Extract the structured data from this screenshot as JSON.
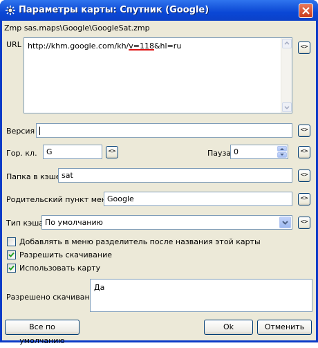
{
  "window": {
    "title": "Параметры карты: Спутник (Google)"
  },
  "zmp_line": "Zmp  sas.maps\\Google\\GoogleSat.zmp",
  "url": {
    "label": "URL",
    "value_prefix": "http://khm.google.com/kh/",
    "value_highlight": "v=118",
    "value_suffix": "&hl=ru",
    "reset_label": "<>"
  },
  "version": {
    "label": "Версия",
    "value": "",
    "reset_label": "<>"
  },
  "hotkey": {
    "label": "Гор. кл.",
    "value": "G",
    "reset_label": "<>"
  },
  "pause": {
    "label": "Пауза",
    "value": "0",
    "reset_label": "<>"
  },
  "cache_folder": {
    "label": "Папка в кэше",
    "value": "sat",
    "reset_label": "<>"
  },
  "parent_menu": {
    "label": "Родительский пункт меню",
    "value": "Google",
    "reset_label": "<>"
  },
  "cache_type": {
    "label": "Тип кэша",
    "value": "По умолчанию",
    "reset_label": "<>"
  },
  "checkboxes": [
    {
      "label": "Добавлять в меню разделитель после названия этой карты",
      "checked": false
    },
    {
      "label": "Разрешить скачивание",
      "checked": true
    },
    {
      "label": "Использовать карту",
      "checked": true
    }
  ],
  "download_info": {
    "label": "Разрешено скачивание",
    "value": "Да"
  },
  "buttons": {
    "defaults": "Все по умолчанию",
    "ok": "Ok",
    "cancel": "Отменить"
  }
}
